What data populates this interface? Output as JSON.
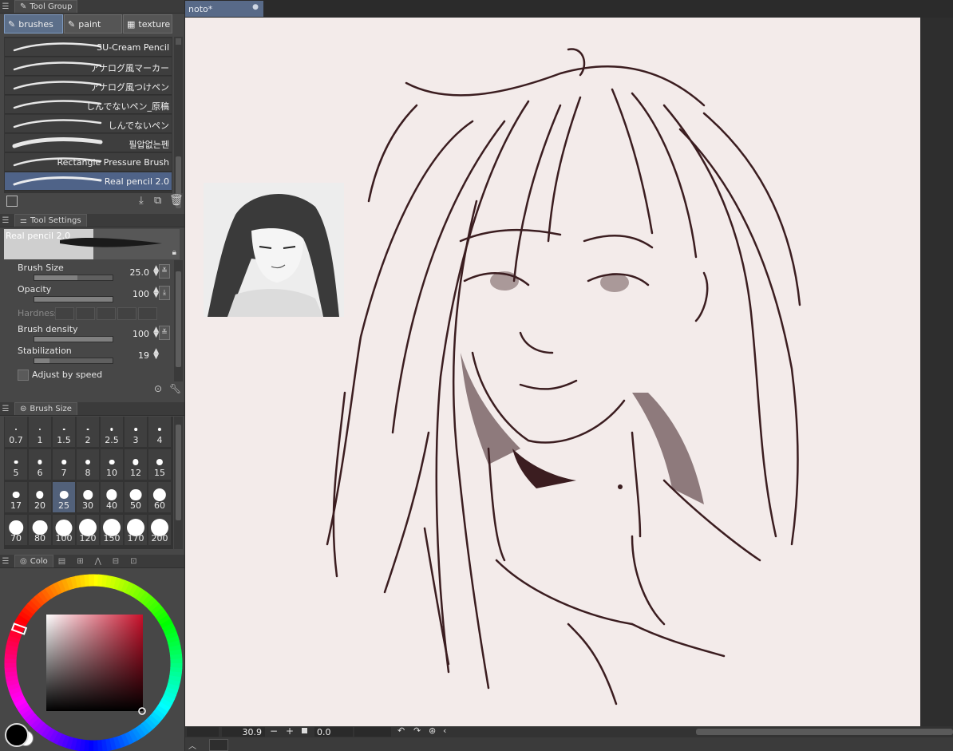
{
  "tool_group": {
    "title": "Tool Group",
    "tabs": [
      {
        "label": "brushes",
        "selected": true
      },
      {
        "label": "paint",
        "selected": false
      },
      {
        "label": "texture",
        "selected": false
      }
    ],
    "brushes": [
      {
        "label": "SU-Cream Pencil",
        "selected": false
      },
      {
        "label": "アナログ風マーカー",
        "selected": false
      },
      {
        "label": "アナログ風つけペン",
        "selected": false
      },
      {
        "label": "しんでないペン_原稿",
        "selected": false
      },
      {
        "label": "しんでないペン",
        "selected": false
      },
      {
        "label": "필압없는펜",
        "selected": false
      },
      {
        "label": "Rectangle Pressure Brush",
        "selected": false
      },
      {
        "label": "Real pencil 2.0",
        "selected": true
      }
    ]
  },
  "tool_settings": {
    "title": "Tool Settings",
    "preview_label": "Real pencil 2.0",
    "params": [
      {
        "label": "Brush Size",
        "value": "25.0",
        "level": 0.55
      },
      {
        "label": "Opacity",
        "value": "100",
        "level": 1.0
      },
      {
        "label": "Hardness",
        "value": "",
        "level": null
      },
      {
        "label": "Brush density",
        "value": "100",
        "level": 1.0
      },
      {
        "label": "Stabilization",
        "value": "19",
        "level": 0.19
      }
    ],
    "adjust_by_speed": "Adjust by speed"
  },
  "brush_size_panel": {
    "title": "Brush Size",
    "sizes": [
      "0.7",
      "1",
      "1.5",
      "2",
      "2.5",
      "3",
      "4",
      "5",
      "6",
      "7",
      "8",
      "10",
      "12",
      "15",
      "17",
      "20",
      "25",
      "30",
      "40",
      "50",
      "60",
      "70",
      "80",
      "100",
      "120",
      "150",
      "170",
      "200"
    ],
    "selected": "25"
  },
  "color_panel": {
    "title": "Color",
    "main_color": "#000000",
    "sub_color": "#ffffff",
    "hue_marker": "#d21a2c"
  },
  "document": {
    "tab_title": "noto*"
  },
  "status_bar": {
    "zoom": "30.9",
    "rotation": "0.0"
  },
  "colors": {
    "paper": "#f3ebea",
    "line_art": "#3b1d20",
    "selection": "#586a88"
  }
}
